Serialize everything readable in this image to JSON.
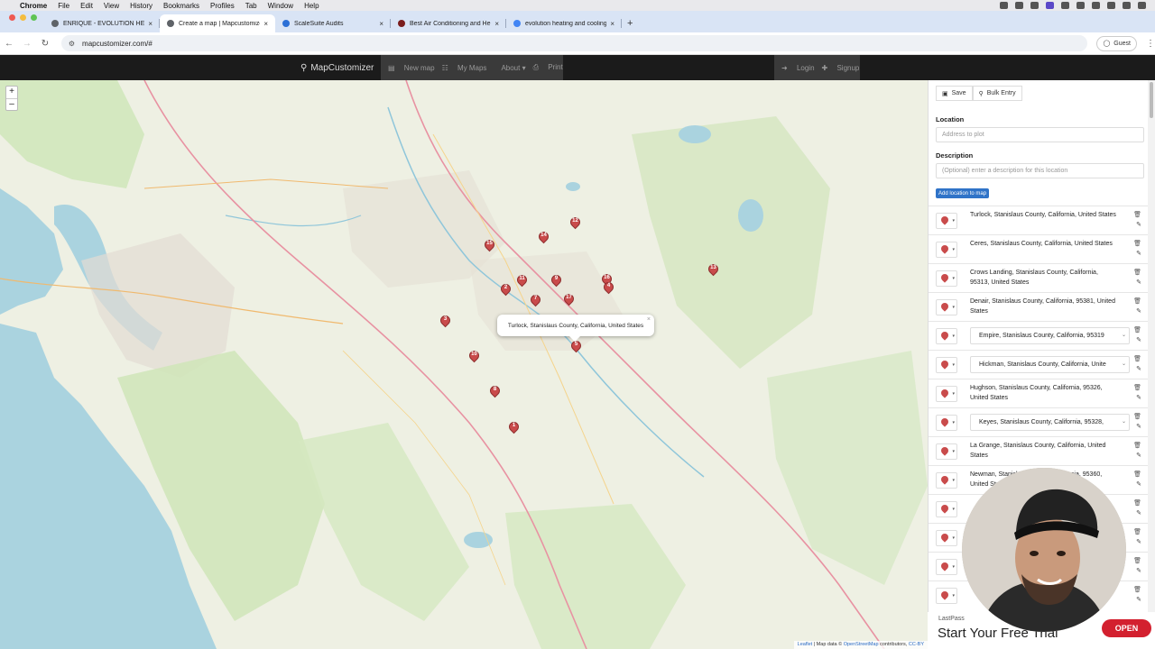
{
  "os_menu": {
    "app": "Chrome",
    "items": [
      "File",
      "Edit",
      "View",
      "History",
      "Bookmarks",
      "Profiles",
      "Tab",
      "Window",
      "Help"
    ]
  },
  "tabs": [
    {
      "title": "ENRIQUE - EVOLUTION HEATI",
      "favicon_color": "#5f6368",
      "active": false
    },
    {
      "title": "Create a map | Mapcustomize",
      "favicon_color": "#5f6368",
      "active": true
    },
    {
      "title": "ScaleSuite Audits",
      "favicon_color": "#2b6fd6",
      "active": false
    },
    {
      "title": "Best Air Conditioning and He",
      "favicon_color": "#7a1d1d",
      "active": false
    },
    {
      "title": "evolution heating and cooling",
      "favicon_color": "#4285f4",
      "active": false
    }
  ],
  "address_bar": {
    "url": "mapcustomizer.com/#",
    "profile": "Guest"
  },
  "navbar": {
    "brand": "MapCustomizer",
    "menu": [
      "New map",
      "My Maps",
      "About",
      "Print"
    ],
    "auth": [
      "Login",
      "Signup"
    ]
  },
  "map": {
    "zoom_in": "+",
    "zoom_out": "–",
    "popup_text": "Turlock, Stanislaus County, California, United States",
    "popup_close": "×",
    "attribution": {
      "leaflet": "Leaflet",
      "sep": " | Map data © ",
      "osm": "OpenStreetMap",
      "contrib": " contributors, ",
      "cc": "CC-BY"
    },
    "markers": [
      "12",
      "14",
      "15",
      "11",
      "9",
      "2",
      "16",
      "4",
      "7",
      "17",
      "13",
      "3",
      "10",
      "8",
      "1",
      "5"
    ]
  },
  "panel": {
    "save": "Save",
    "bulk_entry": "Bulk Entry",
    "location_label": "Location",
    "location_placeholder": "Address to plot",
    "description_label": "Description",
    "description_placeholder": "(Optional) enter a description for this location",
    "add_button": "Add location to map",
    "locations": [
      {
        "text": "Turlock, Stanislaus County, California, United States",
        "field": false
      },
      {
        "text": "Ceres, Stanislaus County, California, United States",
        "field": false
      },
      {
        "text": "Crows Landing, Stanislaus County, California, 95313, United States",
        "field": false
      },
      {
        "text": "Denair, Stanislaus County, California, 95381, United States",
        "field": false
      },
      {
        "text": "Empire, Stanislaus County, California, 95319",
        "field": true
      },
      {
        "text": "Hickman, Stanislaus County, California, Unite",
        "field": true
      },
      {
        "text": "Hughson, Stanislaus County, California, 95326, United States",
        "field": false
      },
      {
        "text": "Keyes, Stanislaus County, California, 95328,",
        "field": true
      },
      {
        "text": "La Grange, Stanislaus County, California, United States",
        "field": false
      },
      {
        "text": "Newman, Stanislaus County, California, 95360, United States",
        "field": false
      },
      {
        "text": "",
        "field": false
      },
      {
        "text": "",
        "field": false
      },
      {
        "text": "",
        "field": false
      },
      {
        "text": "",
        "field": false
      }
    ]
  },
  "ad": {
    "source": "LastPass",
    "title": "Start Your Free Trial",
    "cta": "OPEN"
  },
  "colors": {
    "navbar": "#1b1b1b",
    "marker": "#c94b4b",
    "add_button": "#2f73c8",
    "ad_cta": "#d3202f"
  }
}
